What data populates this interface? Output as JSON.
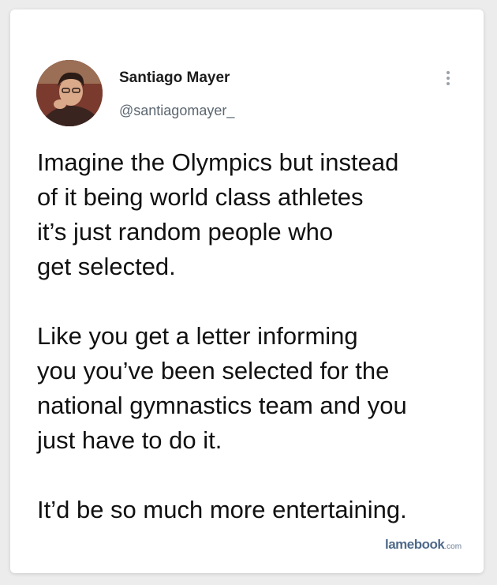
{
  "tweet": {
    "author_name": "Santiago Mayer",
    "author_handle": "@santiagomayer_",
    "avatar_icon": "user-avatar-photo",
    "menu_icon": "vertical-ellipsis-icon",
    "paragraphs": [
      [
        "Imagine the Olympics but instead",
        "of it being world class athletes",
        "it’s just random people who",
        "get selected."
      ],
      [
        "Like you get a letter informing",
        "you you’ve been selected for the",
        "national gymnastics team and you",
        "just have to do it."
      ],
      [
        "It’d be so much more entertaining."
      ]
    ]
  },
  "watermark": {
    "main": "lamebook",
    "tld": ".com"
  },
  "colors": {
    "page_background": "#ececec",
    "card_background": "#ffffff",
    "text": "#111111",
    "handle": "#5b6670",
    "watermark": "#4f6a8a"
  }
}
